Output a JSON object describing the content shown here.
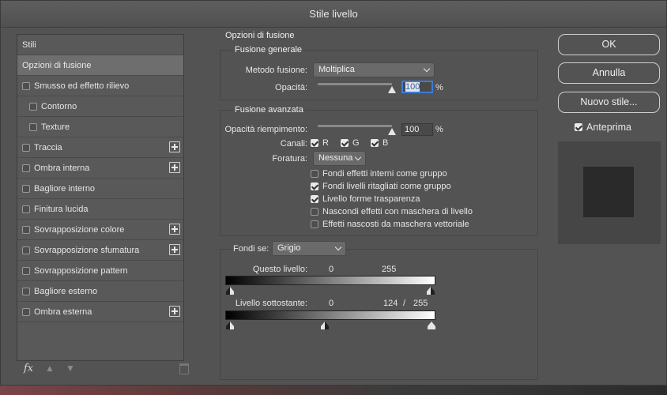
{
  "window": {
    "title": "Stile livello"
  },
  "styles_list": [
    {
      "label": "Stili",
      "check": false,
      "indent": 0,
      "active": false,
      "plus": false
    },
    {
      "label": "Opzioni di fusione",
      "check": false,
      "indent": 0,
      "active": true,
      "plus": false
    },
    {
      "label": "Smusso ed effetto rilievo",
      "check": true,
      "checked": false,
      "indent": 0,
      "active": false,
      "plus": false
    },
    {
      "label": "Contorno",
      "check": true,
      "checked": false,
      "indent": 1,
      "active": false,
      "plus": false
    },
    {
      "label": "Texture",
      "check": true,
      "checked": false,
      "indent": 1,
      "active": false,
      "plus": false
    },
    {
      "label": "Traccia",
      "check": true,
      "checked": false,
      "indent": 0,
      "active": false,
      "plus": true
    },
    {
      "label": "Ombra interna",
      "check": true,
      "checked": false,
      "indent": 0,
      "active": false,
      "plus": true
    },
    {
      "label": "Bagliore interno",
      "check": true,
      "checked": false,
      "indent": 0,
      "active": false,
      "plus": false
    },
    {
      "label": "Finitura lucida",
      "check": true,
      "checked": false,
      "indent": 0,
      "active": false,
      "plus": false
    },
    {
      "label": "Sovrapposizione colore",
      "check": true,
      "checked": false,
      "indent": 0,
      "active": false,
      "plus": true
    },
    {
      "label": "Sovrapposizione sfumatura",
      "check": true,
      "checked": false,
      "indent": 0,
      "active": false,
      "plus": true
    },
    {
      "label": "Sovrapposizione pattern",
      "check": true,
      "checked": false,
      "indent": 0,
      "active": false,
      "plus": false
    },
    {
      "label": "Bagliore esterno",
      "check": true,
      "checked": false,
      "indent": 0,
      "active": false,
      "plus": false
    },
    {
      "label": "Ombra esterna",
      "check": true,
      "checked": false,
      "indent": 0,
      "active": false,
      "plus": true
    }
  ],
  "footer": {
    "fx_label": "fx"
  },
  "blending": {
    "section_title": "Opzioni di fusione",
    "general": {
      "title": "Fusione generale",
      "mode_label": "Metodo fusione:",
      "mode_value": "Moltiplica",
      "opacity_label": "Opacità:",
      "opacity_value": "100",
      "opacity_fraction": 1.0,
      "percent": "%"
    },
    "advanced": {
      "title": "Fusione avanzata",
      "fill_label": "Opacità riempimento:",
      "fill_value": "100",
      "fill_fraction": 1.0,
      "percent": "%",
      "channels_label": "Canali:",
      "channels": [
        {
          "label": "R",
          "checked": true
        },
        {
          "label": "G",
          "checked": true
        },
        {
          "label": "B",
          "checked": true
        }
      ],
      "knockout_label": "Foratura:",
      "knockout_value": "Nessuna",
      "options": [
        {
          "label": "Fondi effetti interni come gruppo",
          "checked": false
        },
        {
          "label": "Fondi livelli ritagliati come gruppo",
          "checked": true
        },
        {
          "label": "Livello forme trasparenza",
          "checked": true
        },
        {
          "label": "Nascondi effetti con maschera di livello",
          "checked": false
        },
        {
          "label": "Effetti nascosti da maschera vettoriale",
          "checked": false
        }
      ]
    },
    "blend_if": {
      "label": "Fondi se:",
      "value": "Grigio",
      "this_layer": {
        "label": "Questo livello:",
        "min": "0",
        "max": "255"
      },
      "underlying": {
        "label": "Livello sottostante:",
        "min": "0",
        "mid": "124",
        "slash": "/",
        "max": "255"
      }
    }
  },
  "buttons": {
    "ok": "OK",
    "cancel": "Annulla",
    "new_style": "Nuovo stile..."
  },
  "preview": {
    "label": "Anteprima",
    "checked": true
  }
}
